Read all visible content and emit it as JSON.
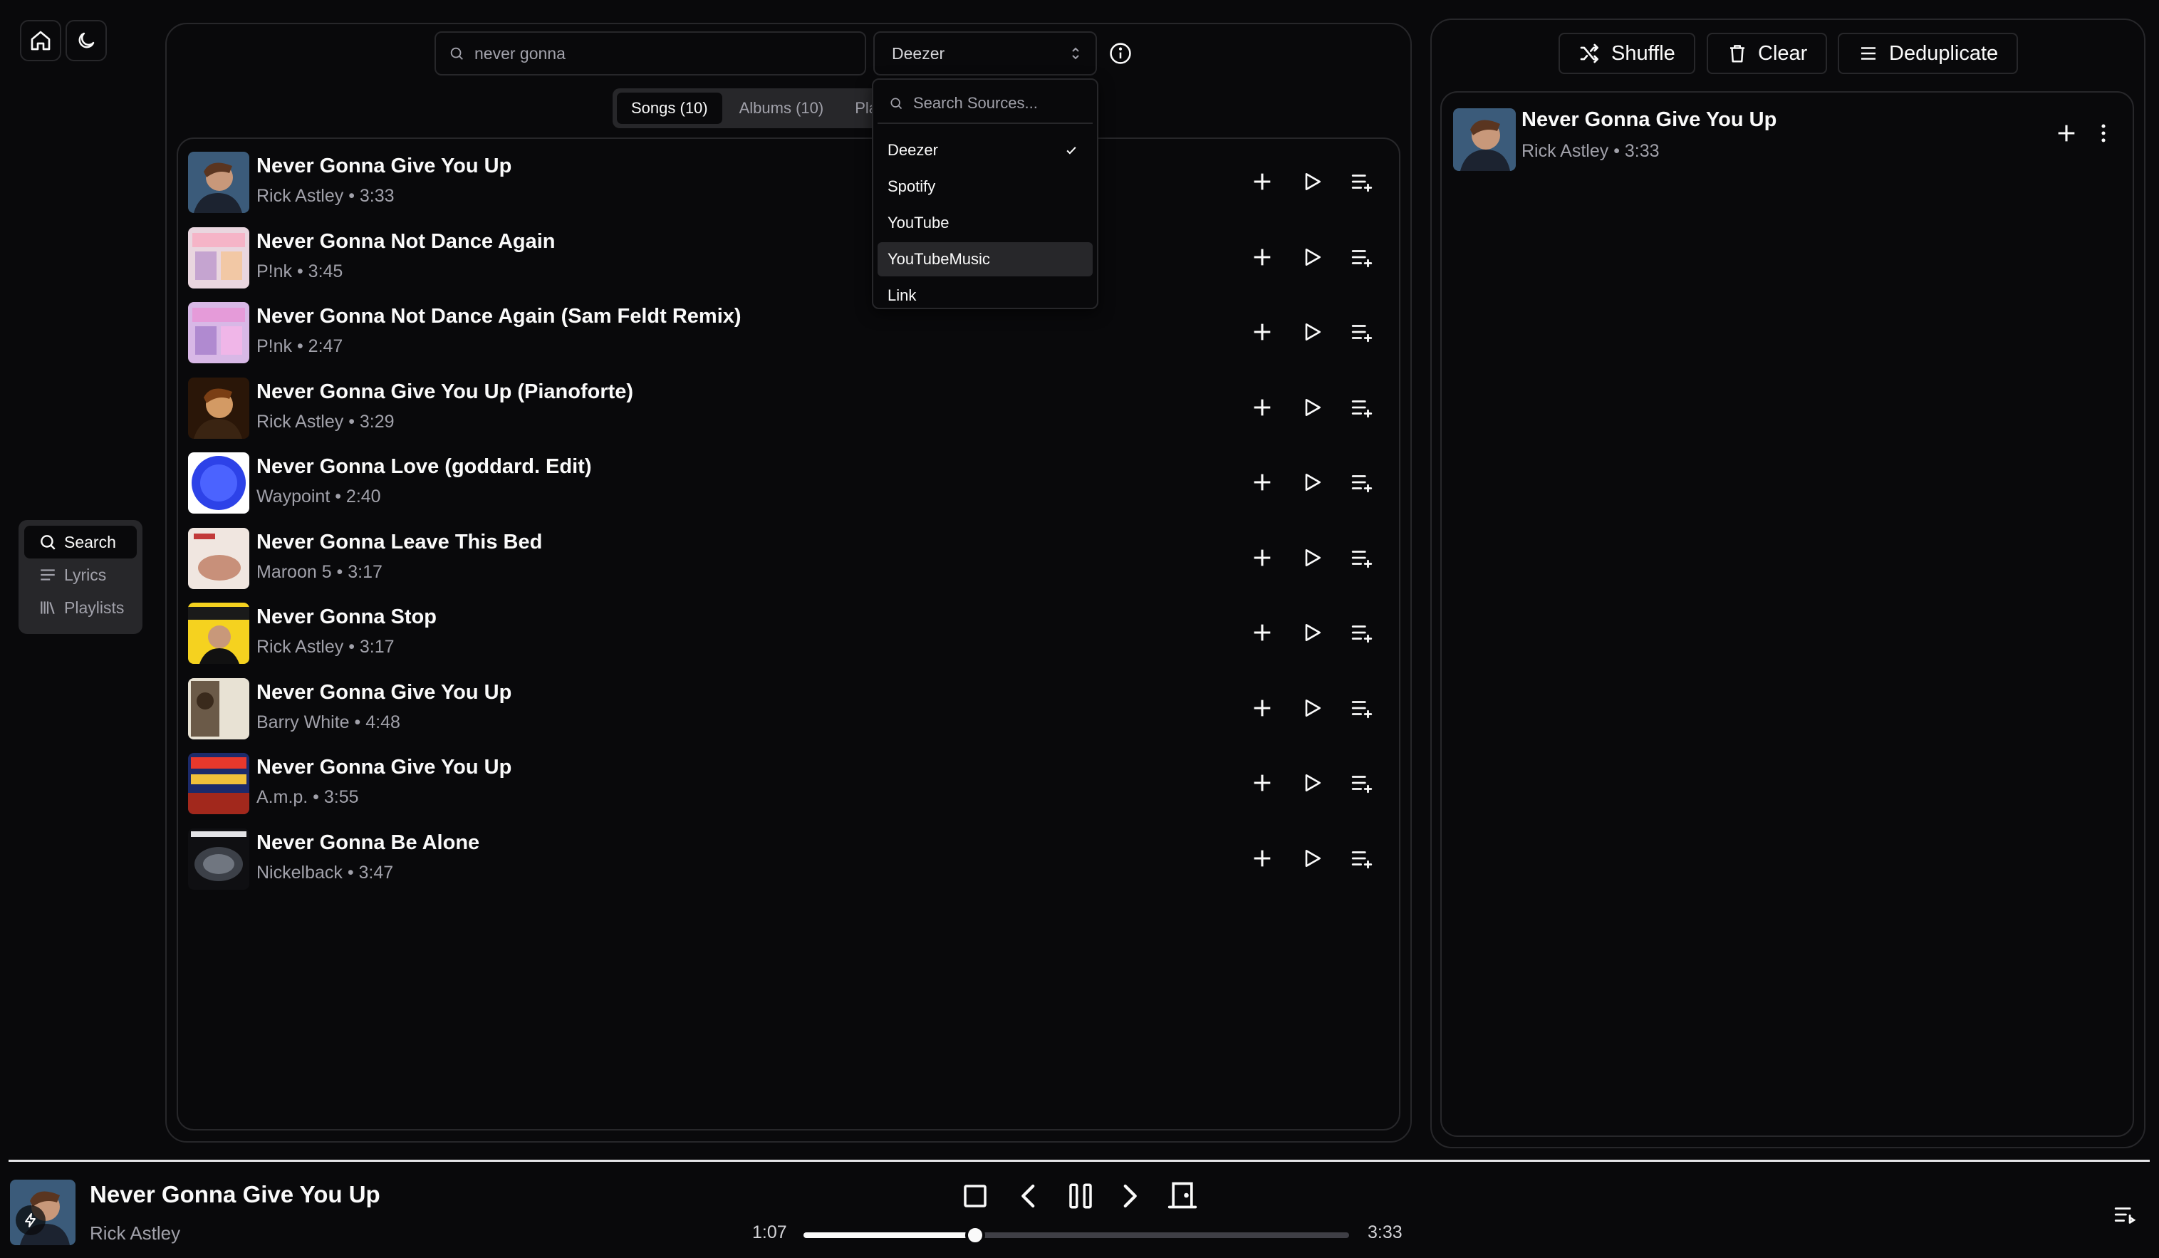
{
  "search": {
    "value": "never gonna"
  },
  "source_select": {
    "selected": "Deezer"
  },
  "tabs": [
    {
      "label": "Songs (10)"
    },
    {
      "label": "Albums (10)"
    },
    {
      "label": "Pla"
    }
  ],
  "songs": [
    {
      "title": "Never Gonna Give You Up",
      "subtitle": "Rick Astley • 3:33"
    },
    {
      "title": "Never Gonna Not Dance Again",
      "subtitle": "P!nk • 3:45"
    },
    {
      "title": "Never Gonna Not Dance Again (Sam Feldt Remix)",
      "subtitle": "P!nk • 2:47"
    },
    {
      "title": "Never Gonna Give You Up (Pianoforte)",
      "subtitle": "Rick Astley • 3:29"
    },
    {
      "title": "Never Gonna Love (goddard. Edit)",
      "subtitle": "Waypoint • 2:40"
    },
    {
      "title": "Never Gonna Leave This Bed",
      "subtitle": "Maroon 5 • 3:17"
    },
    {
      "title": "Never Gonna Stop",
      "subtitle": "Rick Astley • 3:17"
    },
    {
      "title": "Never Gonna Give You Up",
      "subtitle": "Barry White • 4:48"
    },
    {
      "title": "Never Gonna Give You Up",
      "subtitle": "A.m.p. • 3:55"
    },
    {
      "title": "Never Gonna Be Alone",
      "subtitle": "Nickelback • 3:47"
    }
  ],
  "dropdown": {
    "placeholder": "Search Sources...",
    "items": [
      {
        "label": "Deezer",
        "checked": true
      },
      {
        "label": "Spotify"
      },
      {
        "label": "YouTube"
      },
      {
        "label": "YouTubeMusic",
        "highlighted": true
      },
      {
        "label": "Link"
      }
    ]
  },
  "nav": {
    "items": [
      {
        "label": "Search",
        "active": true
      },
      {
        "label": "Lyrics"
      },
      {
        "label": "Playlists"
      }
    ]
  },
  "queue": {
    "shuffle_label": "Shuffle",
    "clear_label": "Clear",
    "dedupe_label": "Deduplicate",
    "items": [
      {
        "title": "Never Gonna Give You Up",
        "subtitle": "Rick Astley • 3:33"
      }
    ]
  },
  "player": {
    "title": "Never Gonna Give You Up",
    "artist": "Rick Astley",
    "elapsed": "1:07",
    "duration": "3:33",
    "progress": 0.3146
  },
  "colors": {
    "background": "#09090b",
    "border": "#27272a",
    "muted_text": "#a1a1aa",
    "text": "#fafafa"
  }
}
